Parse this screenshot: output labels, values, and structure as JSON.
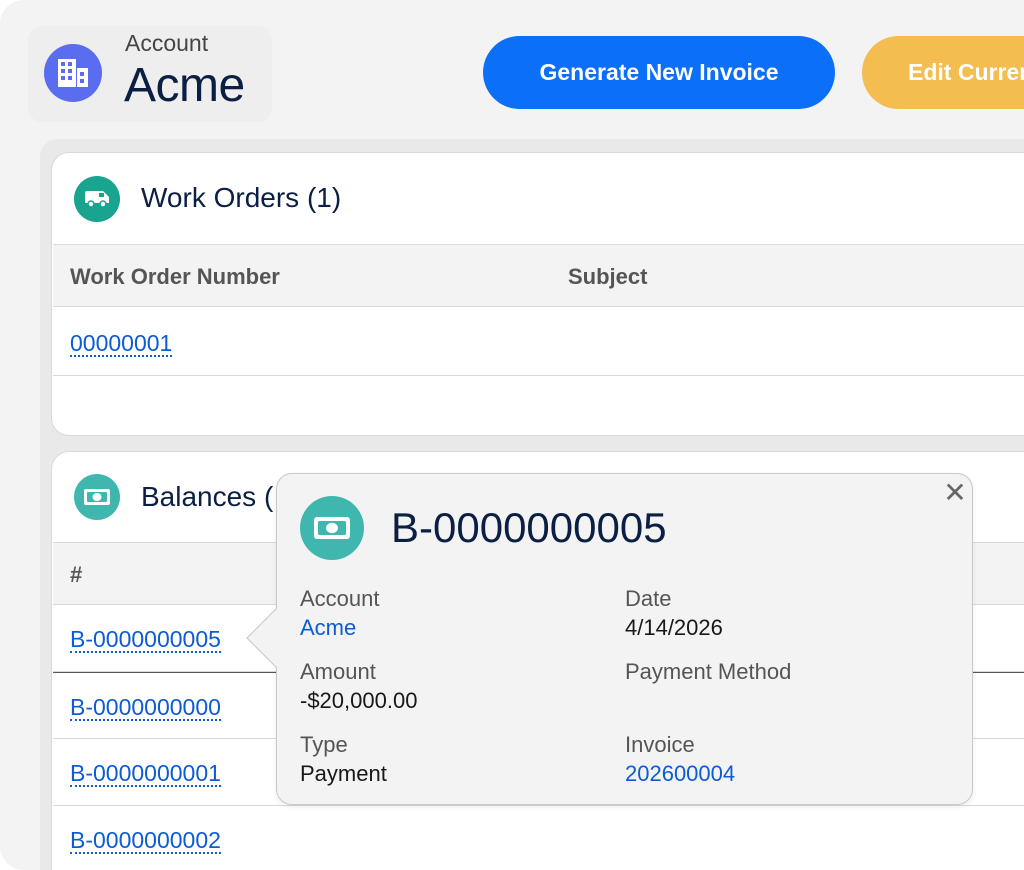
{
  "header": {
    "account_label": "Account",
    "account_name": "Acme",
    "generate_button": "Generate New Invoice",
    "edit_button": "Edit Currency"
  },
  "work_orders": {
    "title": "Work Orders (1)",
    "columns": [
      "Work Order Number",
      "Subject"
    ],
    "rows": [
      {
        "number": "00000001",
        "subject": ""
      }
    ]
  },
  "balances": {
    "title": "Balances (",
    "columns": [
      "#"
    ],
    "rows": [
      "B-0000000005",
      "B-0000000000",
      "B-0000000001",
      "B-0000000002"
    ]
  },
  "popover": {
    "title": "B-0000000005",
    "close_symbol": "✕",
    "fields": {
      "account_label": "Account",
      "account_value": "Acme",
      "date_label": "Date",
      "date_value": "4/14/2026",
      "amount_label": "Amount",
      "amount_value": "-$20,000.00",
      "payment_method_label": "Payment Method",
      "payment_method_value": "",
      "type_label": "Type",
      "type_value": "Payment",
      "invoice_label": "Invoice",
      "invoice_value": "202600004"
    }
  },
  "colors": {
    "primary_button": "#0b6ff7",
    "secondary_button": "#f3bd4f",
    "account_icon": "#5a6df0",
    "work_order_icon": "#18a48f",
    "balance_icon": "#3fb6ae",
    "link": "#0b5cd5",
    "heading": "#0b1e43"
  },
  "icons": {
    "account": "building-icon",
    "work_orders": "truck-icon",
    "balances": "money-icon",
    "popover": "money-icon",
    "close": "close-icon"
  }
}
